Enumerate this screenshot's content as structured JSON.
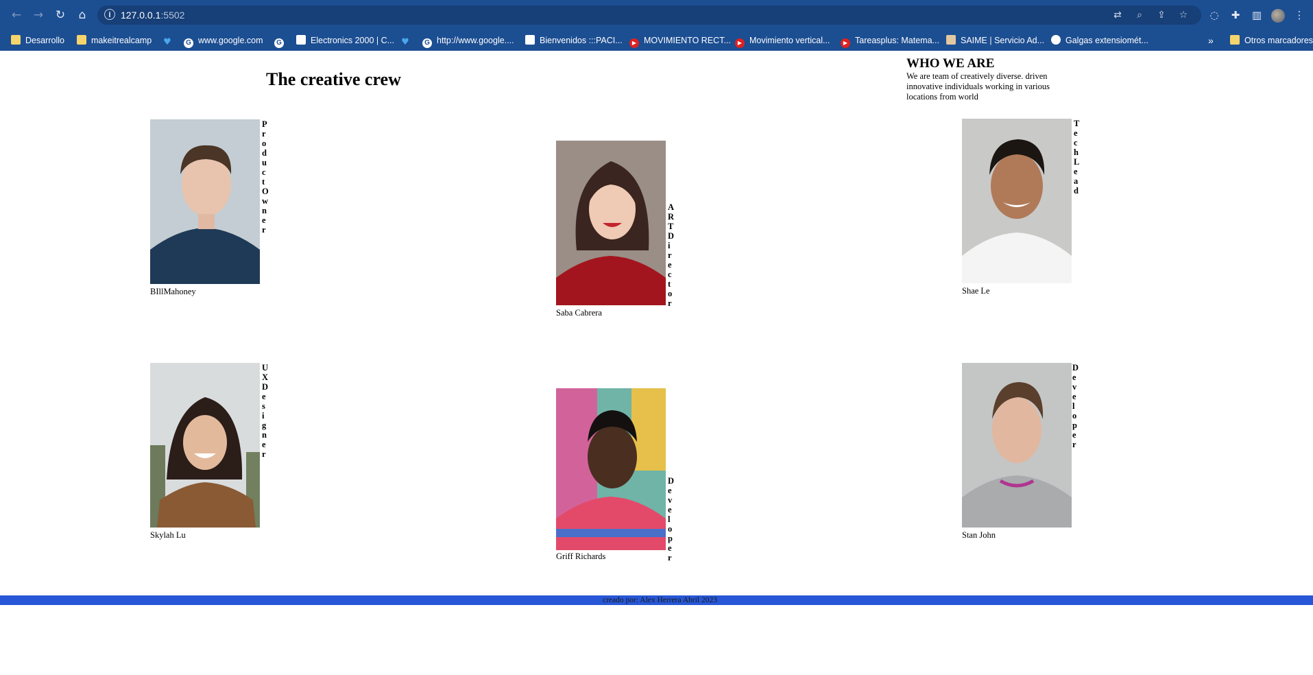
{
  "browser": {
    "url_host": "127.0.0.1",
    "url_port": ":5502",
    "bookmarks": [
      {
        "label": "Desarrollo",
        "icon": "folder-icon"
      },
      {
        "label": "makeitrealcamp",
        "icon": "folder-icon"
      },
      {
        "label": "",
        "icon": "twitter-icon"
      },
      {
        "label": "www.google.com",
        "icon": "google-icon"
      },
      {
        "label": "",
        "icon": "google-icon"
      },
      {
        "label": "Electronics 2000 | C...",
        "icon": "document-icon"
      },
      {
        "label": "",
        "icon": "twitter-icon"
      },
      {
        "label": "http://www.google....",
        "icon": "google-icon"
      },
      {
        "label": "Bienvenidos :::PACI...",
        "icon": "document-icon"
      },
      {
        "label": "MOVIMIENTO RECT...",
        "icon": "youtube-icon"
      },
      {
        "label": "Movimiento vertical...",
        "icon": "youtube-icon"
      },
      {
        "label": "Tareasplus: Matema...",
        "icon": "youtube-icon"
      },
      {
        "label": "SAIME | Servicio Ad...",
        "icon": "misc-site-icon"
      },
      {
        "label": "Galgas extensiomét...",
        "icon": "globe-icon"
      },
      {
        "label": "Otros marcadores",
        "icon": "folder-icon"
      }
    ],
    "overflow_label": "»"
  },
  "page": {
    "title": "The creative crew",
    "who_heading": "WHO WE ARE",
    "who_text": "We are team of creatively diverse. driven innovative individuals working in various locations from world"
  },
  "members": [
    {
      "name": "BIllMahoney",
      "role": "Product Owner"
    },
    {
      "name": "Saba Cabrera",
      "role": "ART Director"
    },
    {
      "name": "Shae Le",
      "role": "Tech Lead"
    },
    {
      "name": "Skylah Lu",
      "role": "UX Designer"
    },
    {
      "name": "Griff Richards",
      "role": "Developer"
    },
    {
      "name": "Stan John",
      "role": "Developer"
    }
  ],
  "footer": {
    "text": "creado por: Alex Herrera Abril 2023"
  },
  "colors": {
    "browser_chrome": "#1c4e92",
    "footer_bar": "#2757d6"
  }
}
